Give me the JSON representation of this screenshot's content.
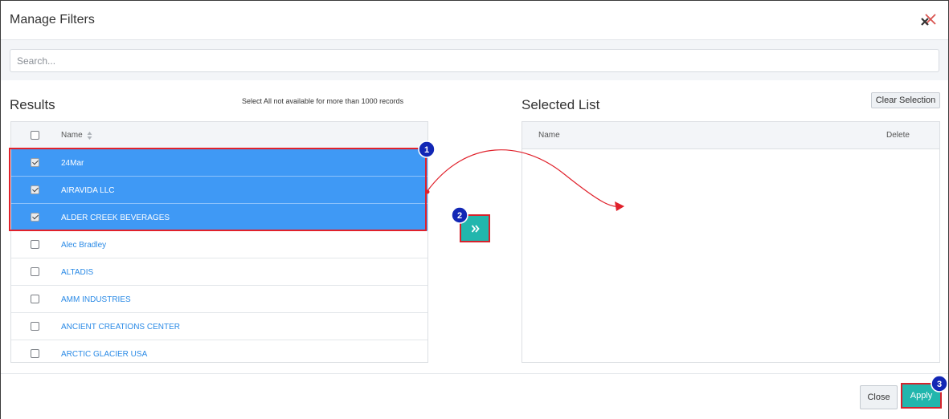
{
  "dialog": {
    "title": "Manage Filters"
  },
  "search": {
    "placeholder": "Search..."
  },
  "results": {
    "heading": "Results",
    "note": "Select All not available for more than 1000 records",
    "column_name": "Name",
    "rows": [
      {
        "label": "24Mar",
        "checked": true
      },
      {
        "label": "AIRAVIDA LLC",
        "checked": true
      },
      {
        "label": "ALDER CREEK BEVERAGES",
        "checked": true
      },
      {
        "label": "Alec Bradley",
        "checked": false
      },
      {
        "label": "ALTADIS",
        "checked": false
      },
      {
        "label": "AMM INDUSTRIES",
        "checked": false
      },
      {
        "label": "ANCIENT CREATIONS CENTER",
        "checked": false
      },
      {
        "label": "ARCTIC GLACIER USA",
        "checked": false
      }
    ]
  },
  "selected_list": {
    "heading": "Selected List",
    "clear_label": "Clear Selection",
    "column_name": "Name",
    "column_delete": "Delete"
  },
  "footer": {
    "close_label": "Close",
    "apply_label": "Apply"
  },
  "annotations": {
    "badges": [
      "1",
      "2",
      "3"
    ],
    "highlight_color": "#e0212b",
    "badge_color": "#1227b5"
  },
  "icons": {
    "close": "close-icon",
    "search_clear": "clear-icon",
    "sort": "sort-icon",
    "move": "double-chevron-right-icon"
  },
  "colors": {
    "accent": "#22b6ad",
    "selected_row": "#3f99f5",
    "link": "#2a8ae6"
  }
}
